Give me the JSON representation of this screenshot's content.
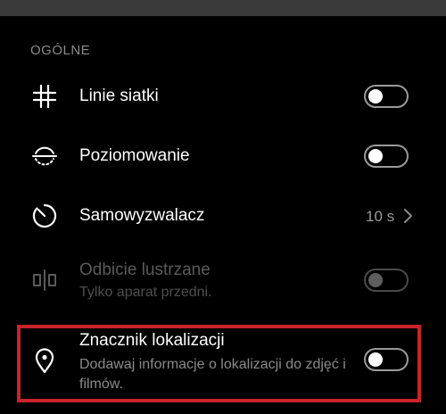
{
  "section": {
    "title": "OGÓLNE"
  },
  "settings": [
    {
      "id": "gridlines",
      "icon": "grid-icon",
      "title": "Linie siatki",
      "control": "toggle",
      "on": false,
      "enabled": true
    },
    {
      "id": "leveling",
      "icon": "level-icon",
      "title": "Poziomowanie",
      "control": "toggle",
      "on": false,
      "enabled": true
    },
    {
      "id": "timer",
      "icon": "timer-icon",
      "title": "Samowyzwalacz",
      "control": "value",
      "value": "10 s",
      "enabled": true
    },
    {
      "id": "mirror",
      "icon": "mirror-icon",
      "title": "Odbicie lustrzane",
      "subtitle": "Tylko aparat przedni.",
      "control": "toggle",
      "on": false,
      "enabled": false
    },
    {
      "id": "location",
      "icon": "location-pin-icon",
      "title": "Znacznik lokalizacji",
      "subtitle": "Dodawaj informacje o lokalizacji do zdjęć i filmów.",
      "control": "toggle",
      "on": false,
      "enabled": true
    }
  ],
  "colors": {
    "highlight": "#c8232a",
    "background": "#000000"
  }
}
